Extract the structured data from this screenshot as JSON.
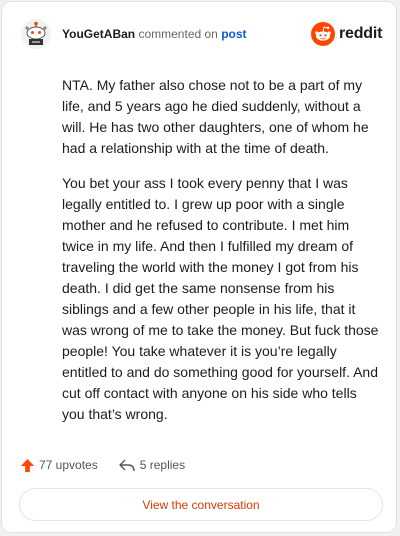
{
  "header": {
    "username": "YouGetABan",
    "action_text": "commented on",
    "post_link": "post"
  },
  "logo": {
    "icon": "reddit-snoo-icon",
    "text": "reddit",
    "color": "#ff4500"
  },
  "comment": {
    "paragraphs": [
      "NTA. My father also chose not to be a part of my life, and 5 years ago he died suddenly, without a will. He has two other daughters, one of whom he had a relationship with at the time of death.",
      "You bet your ass I took every penny that I was legally entitled to. I grew up poor with a single mother and he refused to contribute. I met him twice in my life. And then I fulfilled my dream of traveling the world with the money I got from his death. I did get the same nonsense from his siblings and a few other people in his life, that it was wrong of me to take the money. But fuck those people! You take whatever it is you’re legally entitled to and do something good for yourself. And cut off contact with anyone on his side who tells you that’s wrong."
    ]
  },
  "footer": {
    "upvotes": "77 upvotes",
    "upvote_icon": "upvote-arrow-icon",
    "replies": "5 replies",
    "reply_icon": "reply-icon"
  },
  "cta": {
    "label": "View the conversation",
    "color": "#d93a00"
  }
}
